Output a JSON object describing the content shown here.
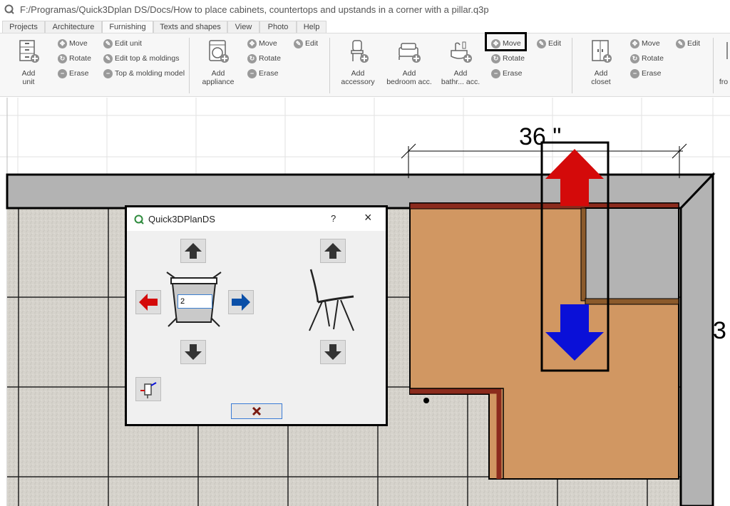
{
  "window": {
    "title": "F:/Programas/Quick3Dplan DS/Docs/How to place cabinets, countertops and upstands in a corner with a pillar.q3p"
  },
  "tabs": [
    {
      "label": "Projects",
      "active": false
    },
    {
      "label": "Architecture",
      "active": false
    },
    {
      "label": "Furnishing",
      "active": true
    },
    {
      "label": "Texts and shapes",
      "active": false
    },
    {
      "label": "View",
      "active": false
    },
    {
      "label": "Photo",
      "active": false
    },
    {
      "label": "Help",
      "active": false
    }
  ],
  "ribbon": {
    "units": {
      "add_unit": [
        "Add",
        "unit"
      ],
      "move": "Move",
      "rotate": "Rotate",
      "erase": "Erase",
      "edit_unit": "Edit unit",
      "edit_top": "Edit top & moldings",
      "top_model": "Top & molding model"
    },
    "appliances": {
      "add": [
        "Add",
        "appliance"
      ],
      "move": "Move",
      "rotate": "Rotate",
      "erase": "Erase",
      "edit": "Edit"
    },
    "accessories": {
      "add_accessory": [
        "Add",
        "accessory"
      ],
      "add_bedroom": [
        "Add",
        "bedroom acc."
      ],
      "add_bathroom": [
        "Add",
        "bathr... acc."
      ],
      "move": "Move",
      "rotate": "Rotate",
      "erase": "Erase",
      "edit": "Edit"
    },
    "closets": {
      "add": [
        "Add",
        "closet"
      ],
      "move": "Move",
      "rotate": "Rotate",
      "erase": "Erase",
      "edit": "Edit"
    },
    "partial": "fro"
  },
  "plan": {
    "dimension_label": "36 \"",
    "dimension_label_right": "3"
  },
  "dialog": {
    "title": "Quick3DPlanDS",
    "help": "?",
    "close": "×",
    "quantity_value": "2"
  },
  "colors": {
    "cabinet": "#d19762",
    "wall": "#b3b3b3",
    "countertop_edge": "#8b2b1d",
    "arrow_up": "#d40a0a",
    "arrow_down": "#0a10d8",
    "highlight": "#000000"
  }
}
